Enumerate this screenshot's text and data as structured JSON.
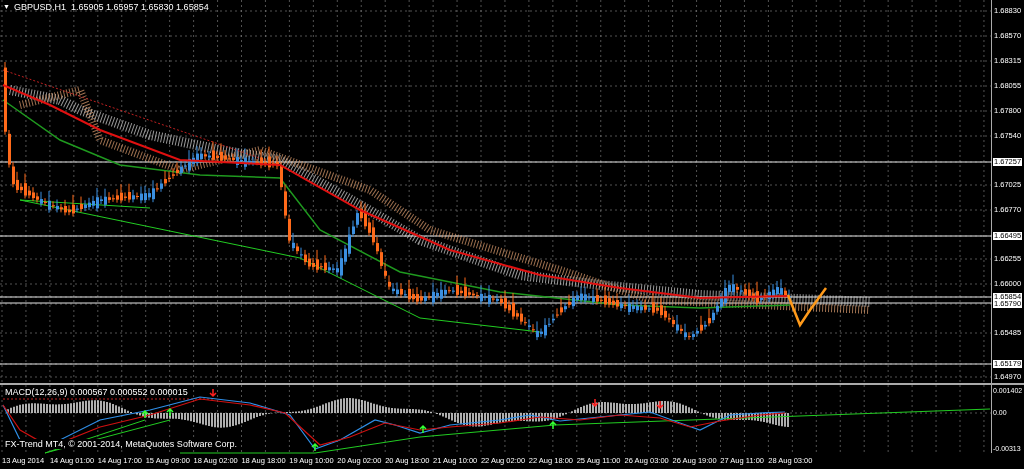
{
  "chart": {
    "menu_glyph": "▼",
    "symbol_info": "GBPUSD,H1  1.65905 1.65957 1.65830 1.65854"
  },
  "price_axis": {
    "labels": [
      {
        "text": "1.68830",
        "kind": "tick"
      },
      {
        "text": "1.68570",
        "kind": "tick"
      },
      {
        "text": "1.68315",
        "kind": "tick"
      },
      {
        "text": "1.68055",
        "kind": "tick"
      },
      {
        "text": "1.67800",
        "kind": "tick"
      },
      {
        "text": "1.67540",
        "kind": "tick"
      },
      {
        "text": "1.67257",
        "kind": "level"
      },
      {
        "text": "1.67025",
        "kind": "tick"
      },
      {
        "text": "1.66770",
        "kind": "tick"
      },
      {
        "text": "1.66495",
        "kind": "level"
      },
      {
        "text": "1.66255",
        "kind": "tick"
      },
      {
        "text": "1.66000",
        "kind": "tick"
      },
      {
        "text": "1.65854",
        "kind": "level"
      },
      {
        "text": "1.65790",
        "kind": "level"
      },
      {
        "text": "1.65485",
        "kind": "tick"
      },
      {
        "text": "1.65179",
        "kind": "level"
      },
      {
        "text": "1.64970",
        "kind": "tick"
      }
    ]
  },
  "macd": {
    "label": "MACD(12,26,9) 0.000567 0.000552 0.000015",
    "copyright": "FX-Trend MT4, © 2001-2014, MetaQuotes Software Corp.",
    "axis_labels": [
      "0.001402",
      "0.00",
      "-0.00313"
    ]
  },
  "time_axis": [
    "13 Aug 2014",
    "14 Aug 01:00",
    "14 Aug 17:00",
    "15 Aug 09:00",
    "18 Aug 02:00",
    "18 Aug 18:00",
    "19 Aug 10:00",
    "20 Aug 02:00",
    "20 Aug 18:00",
    "21 Aug 10:00",
    "22 Aug 02:00",
    "22 Aug 18:00",
    "25 Aug 11:00",
    "26 Aug 03:00",
    "26 Aug 19:00",
    "27 Aug 11:00",
    "28 Aug 03:00"
  ]
}
